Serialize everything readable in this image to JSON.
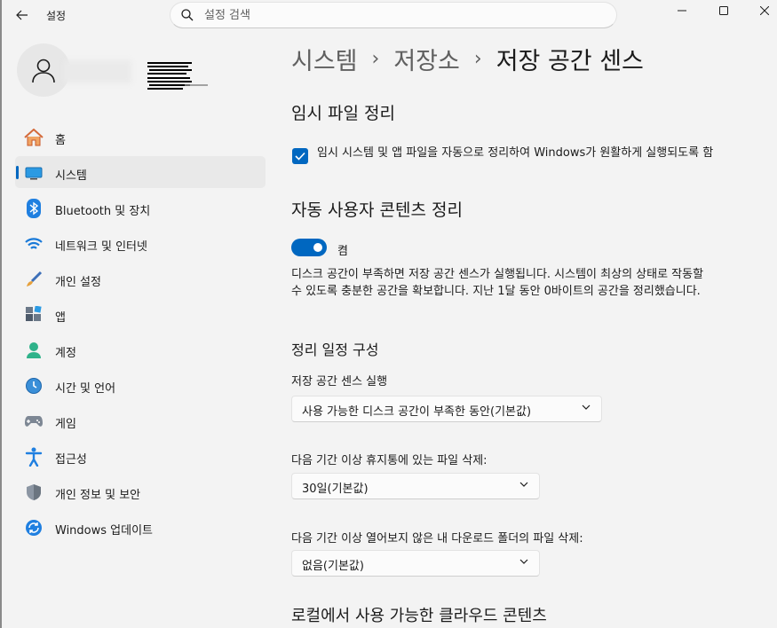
{
  "titlebar": {
    "app_title": "설정",
    "search_placeholder": "설정 검색"
  },
  "sidebar": {
    "items": [
      {
        "label": "홈",
        "icon": "home-icon"
      },
      {
        "label": "시스템",
        "icon": "system-icon",
        "selected": true
      },
      {
        "label": "Bluetooth 및 장치",
        "icon": "bluetooth-icon"
      },
      {
        "label": "네트워크 및 인터넷",
        "icon": "wifi-icon"
      },
      {
        "label": "개인 설정",
        "icon": "brush-icon"
      },
      {
        "label": "앱",
        "icon": "apps-icon"
      },
      {
        "label": "계정",
        "icon": "account-icon"
      },
      {
        "label": "시간 및 언어",
        "icon": "clock-globe-icon"
      },
      {
        "label": "게임",
        "icon": "gamepad-icon"
      },
      {
        "label": "접근성",
        "icon": "accessibility-icon"
      },
      {
        "label": "개인 정보 및 보안",
        "icon": "shield-icon"
      },
      {
        "label": "Windows 업데이트",
        "icon": "update-icon"
      }
    ]
  },
  "breadcrumb": {
    "items": [
      "시스템",
      "저장소"
    ],
    "current": "저장 공간 센스"
  },
  "temp_files": {
    "heading": "임시 파일 정리",
    "checkbox_label": "임시 시스템 및 앱 파일을 자동으로 정리하여 Windows가 원활하게 실행되도록 함",
    "checked": true
  },
  "auto_cleanup": {
    "heading": "자동 사용자 콘텐츠 정리",
    "toggle_state": "켬",
    "description": "디스크 공간이 부족하면 저장 공간 센스가 실행됩니다. 시스템이 최상의 상태로 작동할 수 있도록 충분한 공간을 확보합니다. 지난 1달 동안 0바이트의 공간을 정리했습니다."
  },
  "schedule": {
    "heading": "정리 일정 구성",
    "run_label": "저장 공간 센스 실행",
    "run_value": "사용 가능한 디스크 공간이 부족한 동안(기본값)",
    "recycle_label": "다음 기간 이상 휴지통에 있는 파일 삭제:",
    "recycle_value": "30일(기본값)",
    "downloads_label": "다음 기간 이상 열어보지 않은 내 다운로드 폴더의 파일 삭제:",
    "downloads_value": "없음(기본값)"
  },
  "cloud": {
    "heading": "로컬에서 사용 가능한 클라우드 콘텐츠"
  },
  "colors": {
    "accent": "#0067c0",
    "background": "#f3f3f3"
  }
}
